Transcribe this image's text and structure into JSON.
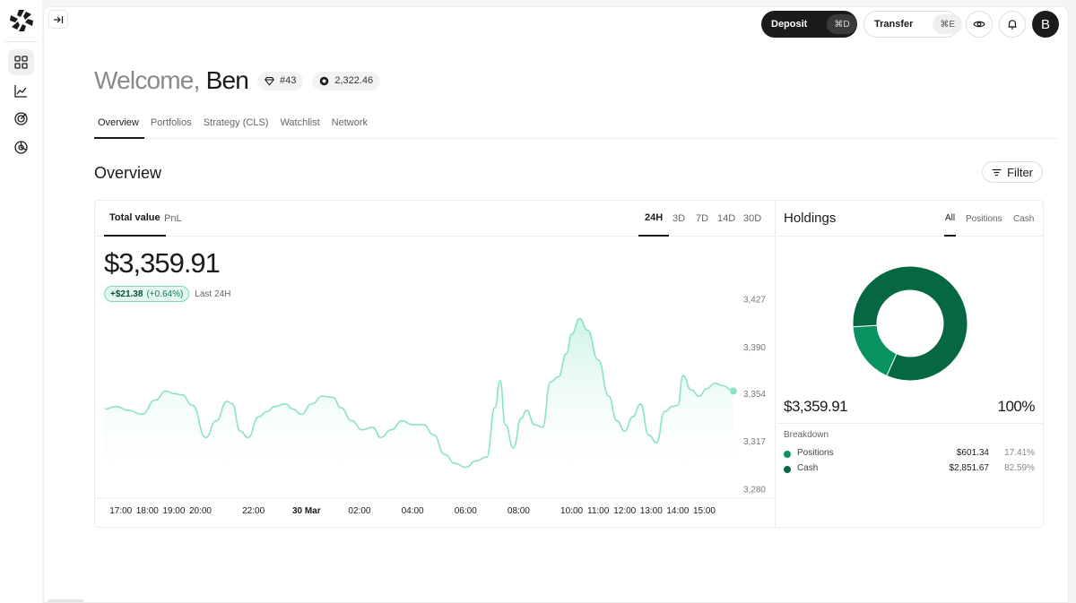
{
  "sidebar": {
    "logo_icon": "app-logo",
    "items": [
      {
        "name": "dashboard-icon",
        "active": true
      },
      {
        "name": "chart-line-icon",
        "active": false
      },
      {
        "name": "target-icon",
        "active": false
      },
      {
        "name": "pie-chart-icon",
        "active": false
      }
    ]
  },
  "header": {
    "collapse_icon": "collapse-sidebar-icon",
    "deposit": {
      "label": "Deposit",
      "shortcut": "⌘D"
    },
    "transfer": {
      "label": "Transfer",
      "shortcut": "⌘E"
    },
    "eye_icon": "eye-icon",
    "bell_icon": "bell-icon",
    "avatar_initial": "B"
  },
  "welcome": {
    "greeting": "Welcome,",
    "name": "Ben",
    "rank": "#43",
    "points": "2,322.46"
  },
  "page_tabs": [
    "Overview",
    "Portfolios",
    "Strategy (CLS)",
    "Watchlist",
    "Network"
  ],
  "section": {
    "title": "Overview",
    "filter_label": "Filter"
  },
  "value_panel": {
    "tabs": [
      "Total value",
      "PnL"
    ],
    "ranges": [
      "24H",
      "3D",
      "7D",
      "14D",
      "30D"
    ],
    "active_range": "24H",
    "total_value": "$3,359.91",
    "change_amount": "+$21.38",
    "change_pct": "(+0.64%)",
    "change_label": "Last 24H"
  },
  "chart_data": {
    "type": "area",
    "title": "",
    "xlabel": "",
    "ylabel": "",
    "ylim": [
      3280,
      3427
    ],
    "y_ticks": [
      3427,
      3390,
      3354,
      3317,
      3280
    ],
    "y_tick_labels": [
      "3,427",
      "3,390",
      "3,354",
      "3,317",
      "3,280"
    ],
    "x_tick_labels": [
      "17:00",
      "18:00",
      "19:00",
      "20:00",
      "22:00",
      "30 Mar",
      "02:00",
      "04:00",
      "06:00",
      "08:00",
      "10:00",
      "11:00",
      "12:00",
      "13:00",
      "14:00",
      "15:00"
    ],
    "x_tick_hours": [
      17,
      18,
      19,
      20,
      22,
      24,
      26,
      28,
      30,
      32,
      34,
      35,
      36,
      37,
      38,
      39
    ],
    "x_range_hours": [
      16.4,
      40.1
    ],
    "line_color": "#8be3c4",
    "series": [
      {
        "x": [
          16.4,
          16.8,
          17.3,
          17.8,
          18.3,
          18.7,
          19.0,
          19.3,
          19.7,
          20.2,
          20.6,
          21.0,
          21.2,
          21.5,
          21.8,
          22.2,
          22.5,
          22.8,
          23.2,
          23.5,
          23.8,
          24.2,
          24.6,
          25.0,
          25.3,
          25.7,
          26.1,
          26.5,
          26.8,
          27.2,
          27.6,
          28.0,
          28.4,
          28.8,
          29.2,
          29.6,
          30.0,
          30.4,
          30.8,
          31.1,
          31.3,
          31.5,
          31.8,
          32.1,
          32.3,
          32.6,
          32.9,
          33.2,
          33.5,
          33.8,
          34.0,
          34.3,
          34.6,
          35.0,
          35.4,
          35.7,
          36.0,
          36.3,
          36.6,
          36.9,
          37.2,
          37.5,
          37.8,
          38.0,
          38.2,
          38.5,
          38.8,
          39.1,
          39.4,
          39.7,
          40.1
        ],
        "y": [
          3342,
          3344,
          3341,
          3338,
          3349,
          3356,
          3354,
          3353,
          3345,
          3320,
          3333,
          3348,
          3346,
          3325,
          3320,
          3336,
          3340,
          3344,
          3346,
          3342,
          3338,
          3346,
          3352,
          3351,
          3343,
          3333,
          3326,
          3328,
          3320,
          3326,
          3333,
          3330,
          3330,
          3322,
          3307,
          3300,
          3297,
          3302,
          3305,
          3343,
          3364,
          3330,
          3312,
          3335,
          3341,
          3330,
          3328,
          3363,
          3367,
          3385,
          3400,
          3412,
          3403,
          3380,
          3352,
          3333,
          3325,
          3336,
          3346,
          3322,
          3316,
          3340,
          3344,
          3345,
          3368,
          3357,
          3352,
          3358,
          3362,
          3360,
          3356
        ]
      }
    ]
  },
  "holdings": {
    "title": "Holdings",
    "tabs": [
      "All",
      "Positions",
      "Cash"
    ],
    "total": "$3,359.91",
    "total_pct": "100%",
    "breakdown_label": "Breakdown",
    "breakdown": [
      {
        "name": "Positions",
        "amount": "$601.34",
        "pct": "17.41%",
        "share": 0.1741,
        "color": "#08925f"
      },
      {
        "name": "Cash",
        "amount": "$2,851.67",
        "pct": "82.59%",
        "share": 0.8259,
        "color": "#056840"
      }
    ]
  }
}
